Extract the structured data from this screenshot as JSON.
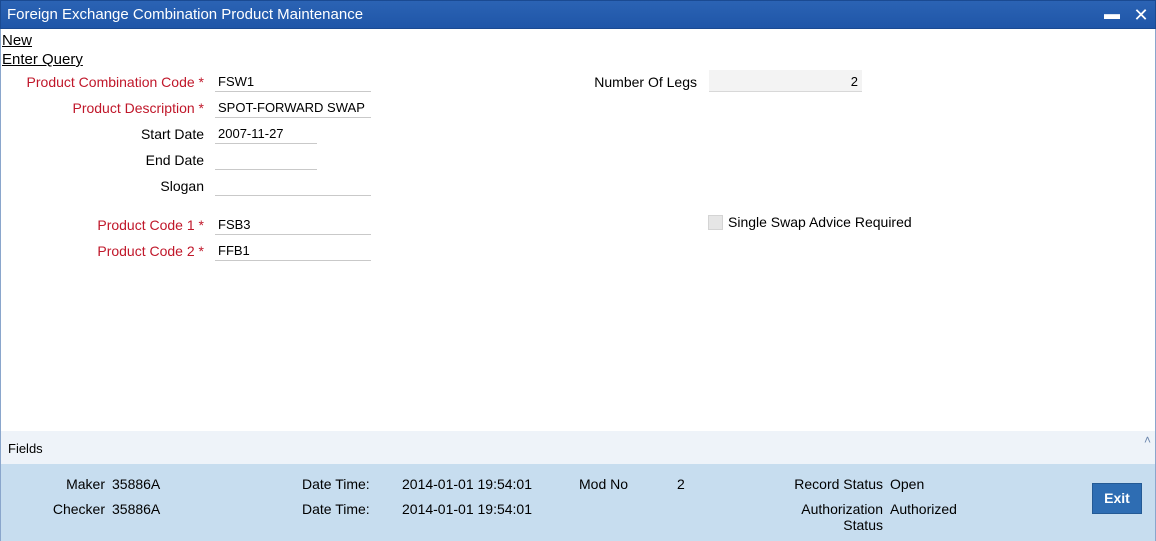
{
  "window": {
    "title": "Foreign Exchange Combination Product Maintenance",
    "minimize_icon": "minimize-icon",
    "close_icon": "close-icon"
  },
  "links": {
    "new": "New",
    "enter_query": "Enter Query"
  },
  "form": {
    "product_combination_code": {
      "label": "Product Combination Code",
      "value": "FSW1",
      "required": true
    },
    "product_description": {
      "label": "Product Description",
      "value": "SPOT-FORWARD SWAP",
      "required": true
    },
    "start_date": {
      "label": "Start Date",
      "value": "2007-11-27"
    },
    "end_date": {
      "label": "End Date",
      "value": ""
    },
    "slogan": {
      "label": "Slogan",
      "value": ""
    },
    "product_code_1": {
      "label": "Product Code 1",
      "value": "FSB3",
      "required": true
    },
    "product_code_2": {
      "label": "Product Code 2",
      "value": "FFB1",
      "required": true
    },
    "number_of_legs": {
      "label": "Number Of Legs",
      "value": "2"
    },
    "single_swap_advice": {
      "label": "Single Swap Advice Required",
      "checked": false
    },
    "required_marker": "*"
  },
  "fields_bar": {
    "label": "Fields",
    "caret_icon": "chevron-up-icon"
  },
  "audit": {
    "maker_label": "Maker",
    "maker_value": "35886A",
    "checker_label": "Checker",
    "checker_value": "35886A",
    "date_time_label": "Date Time:",
    "maker_date_time": "2014-01-01 19:54:01",
    "checker_date_time": "2014-01-01 19:54:01",
    "mod_no_label": "Mod No",
    "mod_no_value": "2",
    "record_status_label": "Record Status",
    "record_status_value": "Open",
    "authorization_status_label_1": "Authorization",
    "authorization_status_label_2": "Status",
    "authorization_status_value": "Authorized"
  },
  "buttons": {
    "exit": "Exit"
  },
  "colors": {
    "titlebar": "#1f56a8",
    "required_label": "#c0172a",
    "footer": "#c7ddef",
    "exit_button": "#2e6db3"
  }
}
